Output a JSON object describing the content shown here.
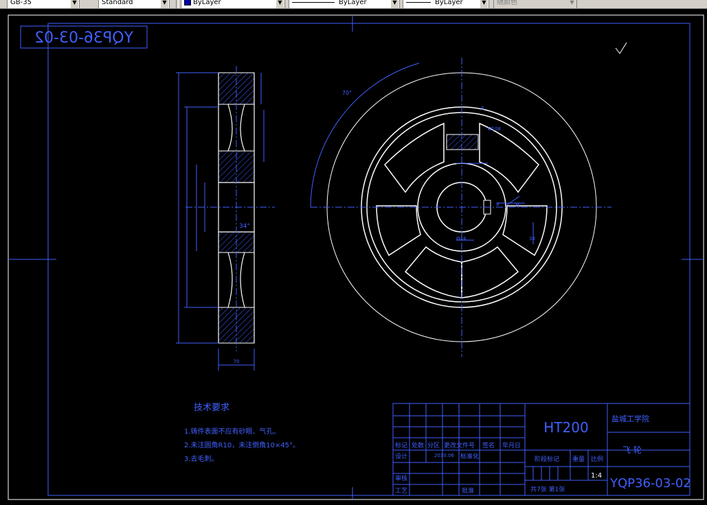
{
  "toolbar": {
    "dimstyle_value": "GB-35",
    "textstyle_value": "Standard",
    "layer_value": "ByLayer",
    "linetype_value": "ByLayer",
    "lineweight_value": "ByLayer",
    "plotstyle_value": "随颜色"
  },
  "drawing": {
    "mirrored_code": "YQP36-03-02",
    "roughness_mark": "",
    "tech_title": "技术要求",
    "tech_reqs": [
      "1.铸件表面不应有砂眼、气孔。",
      "2.未注圆角R10，未注倒角10×45°。",
      "3.去毛刺。"
    ],
    "dims": {
      "arc_angle": "70°",
      "width_bottom": "70",
      "angle_34": "34°",
      "d_r": "R",
      "d_top": "8",
      "key_width": "8",
      "hub_bottom": "Ø44",
      "d_38": "38",
      "right_dim": "Ø108"
    }
  },
  "title_block": {
    "material": "HT200",
    "school": "盐城工学院",
    "part_name": "飞 轮",
    "part_code": "YQP36-03-02",
    "scale": "1:4",
    "row_labels": [
      "标记",
      "处数",
      "分区",
      "更改文件号",
      "签名",
      "年月日"
    ],
    "design_label": "设计",
    "design_date": "2010.06",
    "std_label": "标准化",
    "stage_label": "阶段标记",
    "weight_label": "重量",
    "scale_label": "比例",
    "review_label": "审核",
    "process_label": "工艺",
    "approve_label": "批准",
    "sheet_text": "共7张 第1张"
  }
}
